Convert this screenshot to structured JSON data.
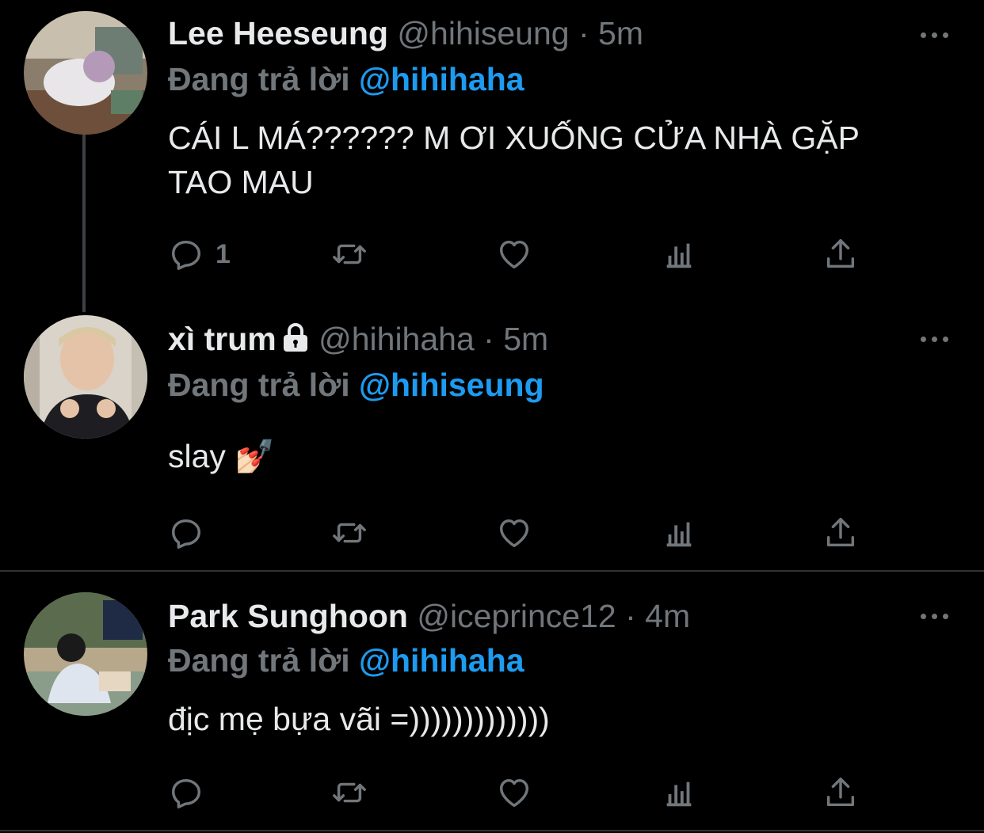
{
  "tweets": [
    {
      "name": "Lee Heeseung",
      "handle": "@hihiseung",
      "dot": "·",
      "time": "5m",
      "replying_prefix": "Đang trả lời",
      "replying_to": "@hihihaha",
      "text": "CÁI L MÁ?????? M ƠI XUỐNG CỬA NHÀ GẶP TAO MAU",
      "reply_count": "1",
      "locked": false
    },
    {
      "name": "xì trum",
      "handle": "@hihihaha",
      "dot": "·",
      "time": "5m",
      "replying_prefix": "Đang trả lời",
      "replying_to": "@hihiseung",
      "text": "slay 💅🏻",
      "reply_count": "",
      "locked": true
    },
    {
      "name": "Park Sunghoon",
      "handle": "@iceprince12",
      "dot": "·",
      "time": "4m",
      "replying_prefix": "Đang trả lời",
      "replying_to": "@hihihaha",
      "text": "địc mẹ bựa vãi =)))))))))))))",
      "reply_count": "",
      "locked": false
    }
  ],
  "icons": [
    "reply-icon",
    "retweet-icon",
    "like-icon",
    "analytics-icon",
    "share-icon",
    "more-icon",
    "lock-icon"
  ],
  "colors": {
    "background": "#000000",
    "text": "#e7e9ea",
    "muted": "#71767b",
    "mention": "#1d9bf0",
    "divider": "#2f3336"
  }
}
